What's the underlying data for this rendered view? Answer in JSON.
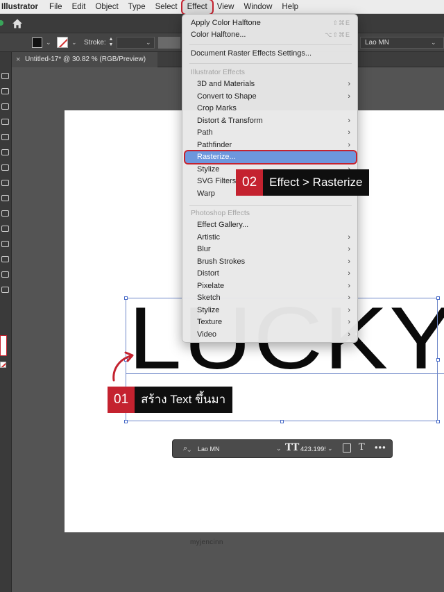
{
  "menubar": {
    "app": "Illustrator",
    "items": [
      "File",
      "Edit",
      "Object",
      "Type",
      "Select",
      "Effect",
      "View",
      "Window",
      "Help"
    ],
    "active": "Effect"
  },
  "control_bar": {
    "stroke_label": "Stroke:",
    "font_name": "Lao MN"
  },
  "document_tab": {
    "title": "Untitled-17* @ 30.82 % (RGB/Preview)",
    "close_glyph": "×"
  },
  "artboard": {
    "text": "LUCKY",
    "watermark": "myjencinn"
  },
  "annotations": {
    "step1": {
      "number": "01",
      "text": "สร้าง Text ขึ้นมา"
    },
    "step2": {
      "number": "02",
      "text": "Effect > Rasterize"
    }
  },
  "type_bar": {
    "font": "Lao MN",
    "size": "423.1995",
    "more": "•••"
  },
  "effect_menu": {
    "apply_last": {
      "label": "Apply Color Halftone",
      "shortcut": "⇧⌘E"
    },
    "last_effect": {
      "label": "Color Halftone...",
      "shortcut": "⌥⇧⌘E"
    },
    "doc_settings": "Document Raster Effects Settings...",
    "illustrator_header": "Illustrator Effects",
    "illustrator_items": [
      {
        "label": "3D and Materials",
        "submenu": true
      },
      {
        "label": "Convert to Shape",
        "submenu": true
      },
      {
        "label": "Crop Marks",
        "submenu": false
      },
      {
        "label": "Distort & Transform",
        "submenu": true
      },
      {
        "label": "Path",
        "submenu": true
      },
      {
        "label": "Pathfinder",
        "submenu": true
      },
      {
        "label": "Rasterize...",
        "submenu": false
      },
      {
        "label": "Stylize",
        "submenu": true
      },
      {
        "label": "SVG Filters",
        "submenu": true
      },
      {
        "label": "Warp",
        "submenu": true
      }
    ],
    "photoshop_header": "Photoshop Effects",
    "photoshop_items": [
      {
        "label": "Effect Gallery...",
        "submenu": false
      },
      {
        "label": "Artistic",
        "submenu": true
      },
      {
        "label": "Blur",
        "submenu": true
      },
      {
        "label": "Brush Strokes",
        "submenu": true
      },
      {
        "label": "Distort",
        "submenu": true
      },
      {
        "label": "Pixelate",
        "submenu": true
      },
      {
        "label": "Sketch",
        "submenu": true
      },
      {
        "label": "Stylize",
        "submenu": true
      },
      {
        "label": "Texture",
        "submenu": true
      },
      {
        "label": "Video",
        "submenu": true
      }
    ],
    "highlighted": "Rasterize...",
    "submenu_glyph": "›"
  },
  "colors": {
    "accent_red": "#c4222f",
    "highlight_blue": "#6d97dd",
    "selection_blue": "#6d86c8"
  }
}
